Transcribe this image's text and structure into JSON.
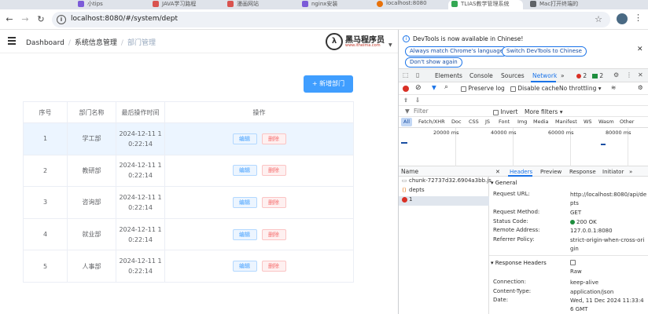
{
  "browser": {
    "tabs": [
      {
        "label": "小tips",
        "color": "#7b5bd8"
      },
      {
        "label": "JAVA学习路程",
        "color": "#d9534f"
      },
      {
        "label": "漫画网站",
        "color": "#d9534f"
      },
      {
        "label": "nginx安装",
        "color": "#7b5bd8"
      },
      {
        "label": "localhost:8080",
        "color": "#e8710a"
      },
      {
        "label": "TLIAS教学管理系统",
        "color": "#34a853"
      },
      {
        "label": "Mac打开终端的",
        "color": "#5f6368"
      }
    ],
    "url": "localhost:8080/#/system/dept"
  },
  "app": {
    "breadcrumb": [
      "Dashboard",
      "系统信息管理",
      "部门管理"
    ],
    "logo": {
      "name": "黑马程序员",
      "site": "www.itheima.com"
    },
    "add_button": "+ 新增部门",
    "table": {
      "headers": [
        "序号",
        "部门名称",
        "最后操作时间",
        "操作"
      ],
      "rows": [
        {
          "idx": "1",
          "name": "学工部",
          "time1": "2024-12-11 1",
          "time2": "0:22:14"
        },
        {
          "idx": "2",
          "name": "教研部",
          "time1": "2024-12-11 1",
          "time2": "0:22:14"
        },
        {
          "idx": "3",
          "name": "咨询部",
          "time1": "2024-12-11 1",
          "time2": "0:22:14"
        },
        {
          "idx": "4",
          "name": "就业部",
          "time1": "2024-12-11 1",
          "time2": "0:22:14"
        },
        {
          "idx": "5",
          "name": "人事部",
          "time1": "2024-12-11 1",
          "time2": "0:22:14"
        }
      ],
      "edit_label": "编辑",
      "delete_label": "删除"
    }
  },
  "devtools": {
    "banner": {
      "message": "DevTools is now available in Chinese!",
      "match_btn": "Always match Chrome's language",
      "switch_btn": "Switch DevTools to Chinese",
      "dont_show": "Don't show again"
    },
    "tabs": [
      "Elements",
      "Console",
      "Sources",
      "Network"
    ],
    "more_tabs": "»",
    "error_count": "2",
    "message_count": "2",
    "toolbar": {
      "preserve_log": "Preserve log",
      "disable_cache": "Disable cache",
      "throttling": "No throttling"
    },
    "filter": {
      "placeholder": "Filter",
      "invert": "Invert",
      "more_filters": "More filters"
    },
    "type_filters": [
      "All",
      "Fetch/XHR",
      "Doc",
      "CSS",
      "JS",
      "Font",
      "Img",
      "Media",
      "Manifest",
      "WS",
      "Wasm",
      "Other"
    ],
    "timeline_labels": [
      "20000 ms",
      "40000 ms",
      "60000 ms",
      "80000 ms"
    ],
    "name_header": "Name",
    "requests": [
      {
        "name": "chunk-72737d32.6904a3bb.js",
        "type": "js"
      },
      {
        "name": "depts",
        "type": "xhr"
      },
      {
        "name": "1",
        "type": "error"
      }
    ],
    "detail_tabs": [
      "Headers",
      "Preview",
      "Response",
      "Initiator"
    ],
    "general": {
      "title": "General",
      "request_url_k": "Request URL:",
      "request_url_v": "http://localhost:8080/api/depts",
      "method_k": "Request Method:",
      "method_v": "GET",
      "status_k": "Status Code:",
      "status_v": "200 OK",
      "remote_k": "Remote Address:",
      "remote_v": "127.0.0.1:8080",
      "referrer_k": "Referrer Policy:",
      "referrer_v": "strict-origin-when-cross-origin"
    },
    "response_headers": {
      "title": "Response Headers",
      "raw": "Raw",
      "connection_k": "Connection:",
      "connection_v": "keep-alive",
      "content_type_k": "Content-Type:",
      "content_type_v": "application/json",
      "date_k": "Date:",
      "date_v": "Wed, 11 Dec 2024 11:33:46 GMT"
    }
  }
}
